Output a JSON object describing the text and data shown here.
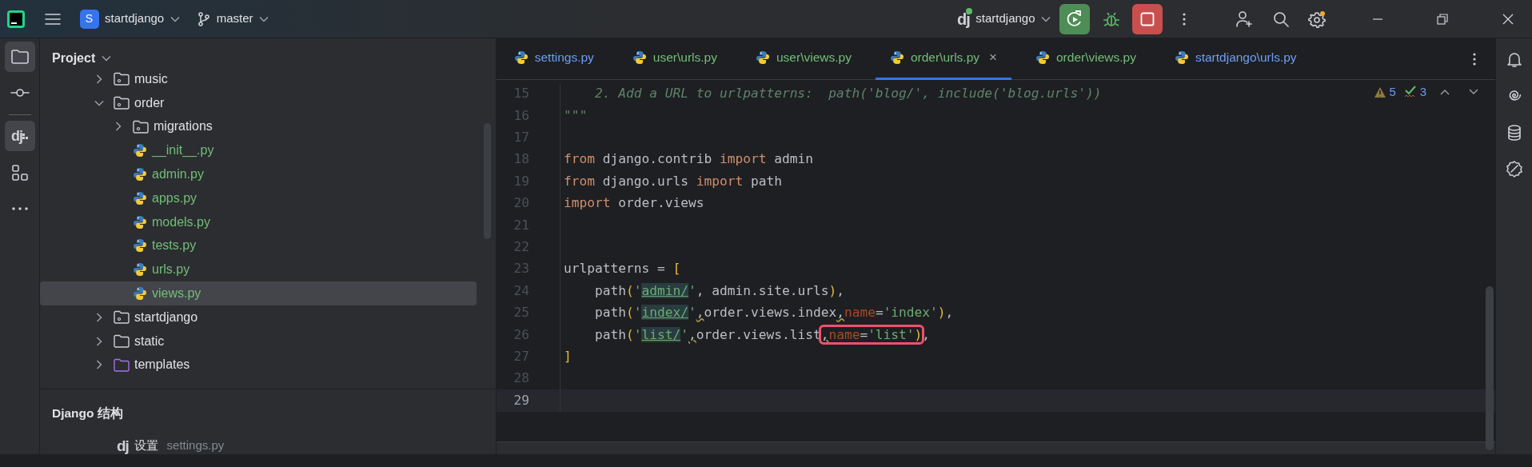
{
  "titlebar": {
    "project": {
      "badge": "S",
      "name": "startdjango"
    },
    "branch": "master",
    "run_config_logo": "dj",
    "run_config": "startdjango"
  },
  "tool_window_bar": {
    "django_logo": "dj"
  },
  "project_panel": {
    "title": "Project",
    "tree": [
      {
        "label": "music",
        "kind": "package",
        "expanded": false,
        "selected": false
      },
      {
        "label": "order",
        "kind": "package",
        "expanded": true,
        "selected": false,
        "children": [
          {
            "label": "migrations",
            "kind": "package",
            "expanded": false,
            "selected": false
          },
          {
            "label": "__init__.py",
            "kind": "python",
            "color": "#73bd79",
            "selected": false
          },
          {
            "label": "admin.py",
            "kind": "python",
            "color": "#73bd79",
            "selected": false
          },
          {
            "label": "apps.py",
            "kind": "python",
            "color": "#73bd79",
            "selected": false
          },
          {
            "label": "models.py",
            "kind": "python",
            "color": "#73bd79",
            "selected": false
          },
          {
            "label": "tests.py",
            "kind": "python",
            "color": "#73bd79",
            "selected": false
          },
          {
            "label": "urls.py",
            "kind": "python",
            "color": "#73bd79",
            "selected": false
          },
          {
            "label": "views.py",
            "kind": "python",
            "color": "#73bd79",
            "selected": true
          }
        ]
      },
      {
        "label": "startdjango",
        "kind": "package",
        "expanded": false,
        "selected": false
      },
      {
        "label": "static",
        "kind": "folder",
        "expanded": false,
        "selected": false
      },
      {
        "label": "templates",
        "kind": "templates",
        "expanded": false,
        "selected": false
      }
    ]
  },
  "django_structure": {
    "title": "Django 结构",
    "items": [
      {
        "logo": "dj",
        "label": "设置",
        "file": "settings.py"
      }
    ]
  },
  "tabs": [
    {
      "label": "settings.py",
      "color": "#6c9ff5",
      "selected": false
    },
    {
      "label": "user\\urls.py",
      "color": "#73bd79",
      "selected": false
    },
    {
      "label": "user\\views.py",
      "color": "#73bd79",
      "selected": false
    },
    {
      "label": "order\\urls.py",
      "color": "#73bd79",
      "selected": true,
      "close": "×"
    },
    {
      "label": "order\\views.py",
      "color": "#73bd79",
      "selected": false
    },
    {
      "label": "startdjango\\urls.py",
      "color": "#6c9ff5",
      "selected": false
    }
  ],
  "inspections": {
    "warnings": "5",
    "weak_warnings": "3"
  },
  "code": [
    {
      "n": "15",
      "current": false,
      "kind": "docstring",
      "text": "    2. Add a URL to urlpatterns:  path('blog/', include('blog.urls'))"
    },
    {
      "n": "16",
      "current": false,
      "kind": "docstring",
      "text": "\"\"\""
    },
    {
      "n": "17",
      "current": false
    },
    {
      "n": "18",
      "current": false,
      "kind": "code",
      "text": "from django.contrib import admin"
    },
    {
      "n": "19",
      "current": false,
      "kind": "code",
      "text": "from django.urls import path"
    },
    {
      "n": "20",
      "current": false,
      "kind": "code",
      "text": "import order.views"
    },
    {
      "n": "21",
      "current": false
    },
    {
      "n": "22",
      "current": false
    },
    {
      "n": "23",
      "current": false,
      "kind": "code",
      "text": "urlpatterns = ["
    },
    {
      "n": "24",
      "current": false,
      "kind": "code",
      "text": "    path('admin/', admin.site.urls),"
    },
    {
      "n": "25",
      "current": false,
      "kind": "code",
      "text": "    path('index/',order.views.index,name='index'),"
    },
    {
      "n": "26",
      "current": false,
      "kind": "code",
      "text": "    path('list/',order.views.list",
      "marked": ",name='list')",
      "tail": ","
    },
    {
      "n": "27",
      "current": false,
      "kind": "code",
      "text": "]"
    },
    {
      "n": "28",
      "current": false
    },
    {
      "n": "29",
      "current": true
    }
  ]
}
